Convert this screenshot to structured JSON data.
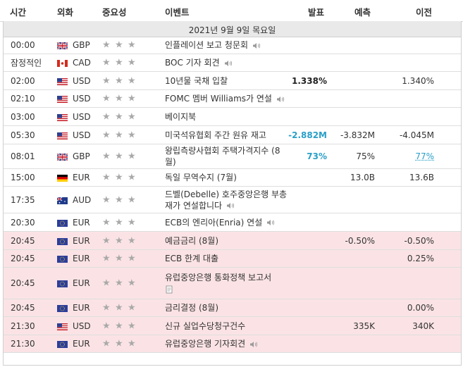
{
  "columns": {
    "time": "시간",
    "currency": "외화",
    "importance": "중요성",
    "event": "이벤트",
    "actual": "발표",
    "forecast": "예측",
    "previous": "이전"
  },
  "date": "2021년 9월 9일 목요일",
  "rows": [
    {
      "time": "00:00",
      "flag": "uk",
      "currency": "GBP",
      "event": "인플레이션 보고 청문회",
      "speaker": true,
      "actual": "",
      "forecast": "",
      "previous": "",
      "hl": false
    },
    {
      "time": "잠정적인",
      "flag": "ca",
      "currency": "CAD",
      "event": "BOC 기자 회견",
      "speaker": true,
      "actual": "",
      "forecast": "",
      "previous": "",
      "hl": false
    },
    {
      "time": "02:00",
      "flag": "us",
      "currency": "USD",
      "event": "10년물 국채 입찰",
      "speaker": false,
      "actual": "1.338%",
      "forecast": "",
      "previous": "1.340%",
      "hl": false
    },
    {
      "time": "02:10",
      "flag": "us",
      "currency": "USD",
      "event": "FOMC 멤버 Williams가 연설",
      "speaker": true,
      "actual": "",
      "forecast": "",
      "previous": "",
      "hl": false
    },
    {
      "time": "03:00",
      "flag": "us",
      "currency": "USD",
      "event": "베이지북",
      "speaker": false,
      "actual": "",
      "forecast": "",
      "previous": "",
      "hl": false
    },
    {
      "time": "05:30",
      "flag": "us",
      "currency": "USD",
      "event": "미국석유협회 주간 원유 재고",
      "speaker": false,
      "actual": "-2.882M",
      "forecast": "-3.832M",
      "previous": "-4.045M",
      "hl": false
    },
    {
      "time": "08:01",
      "flag": "uk",
      "currency": "GBP",
      "event": "왕립측량사협회 주택가격지수 (8월)",
      "speaker": false,
      "actual": "73%",
      "forecast": "75%",
      "previous": "77%",
      "hl": false
    },
    {
      "time": "15:00",
      "flag": "de",
      "currency": "EUR",
      "event": "독일 무역수지 (7월)",
      "speaker": false,
      "actual": "",
      "forecast": "13.0B",
      "previous": "13.6B",
      "hl": false
    },
    {
      "time": "17:35",
      "flag": "au",
      "currency": "AUD",
      "event": "드벨(Debelle) 호주중앙은행 부총재가 연설합니다",
      "speaker": true,
      "actual": "",
      "forecast": "",
      "previous": "",
      "hl": false
    },
    {
      "time": "20:30",
      "flag": "eu",
      "currency": "EUR",
      "event": "ECB의 엔리아(Enria) 연설",
      "speaker": true,
      "actual": "",
      "forecast": "",
      "previous": "",
      "hl": false
    },
    {
      "time": "20:45",
      "flag": "eu",
      "currency": "EUR",
      "event": "예금금리 (8월)",
      "speaker": false,
      "actual": "",
      "forecast": "-0.50%",
      "previous": "-0.50%",
      "hl": true
    },
    {
      "time": "20:45",
      "flag": "eu",
      "currency": "EUR",
      "event": "ECB 한계 대출",
      "speaker": false,
      "actual": "",
      "forecast": "",
      "previous": "0.25%",
      "hl": true
    },
    {
      "time": "20:45",
      "flag": "eu",
      "currency": "EUR",
      "event": "유럽중앙은행 통화정책 보고서",
      "speaker": false,
      "doc": true,
      "actual": "",
      "forecast": "",
      "previous": "",
      "hl": true
    },
    {
      "time": "20:45",
      "flag": "eu",
      "currency": "EUR",
      "event": "금리결정 (8월)",
      "speaker": false,
      "actual": "",
      "forecast": "",
      "previous": "0.00%",
      "hl": true
    },
    {
      "time": "21:30",
      "flag": "us",
      "currency": "USD",
      "event": "신규 실업수당청구건수",
      "speaker": false,
      "actual": "",
      "forecast": "335K",
      "previous": "340K",
      "hl": true
    },
    {
      "time": "21:30",
      "flag": "eu",
      "currency": "EUR",
      "event": "유럽중앙은행 기자회견",
      "speaker": true,
      "actual": "",
      "forecast": "",
      "previous": "",
      "hl": true
    }
  ],
  "colors": {
    "positive": "#2a9fc7",
    "highlight": "#fbe3e5",
    "star": "#a9a9a9"
  }
}
